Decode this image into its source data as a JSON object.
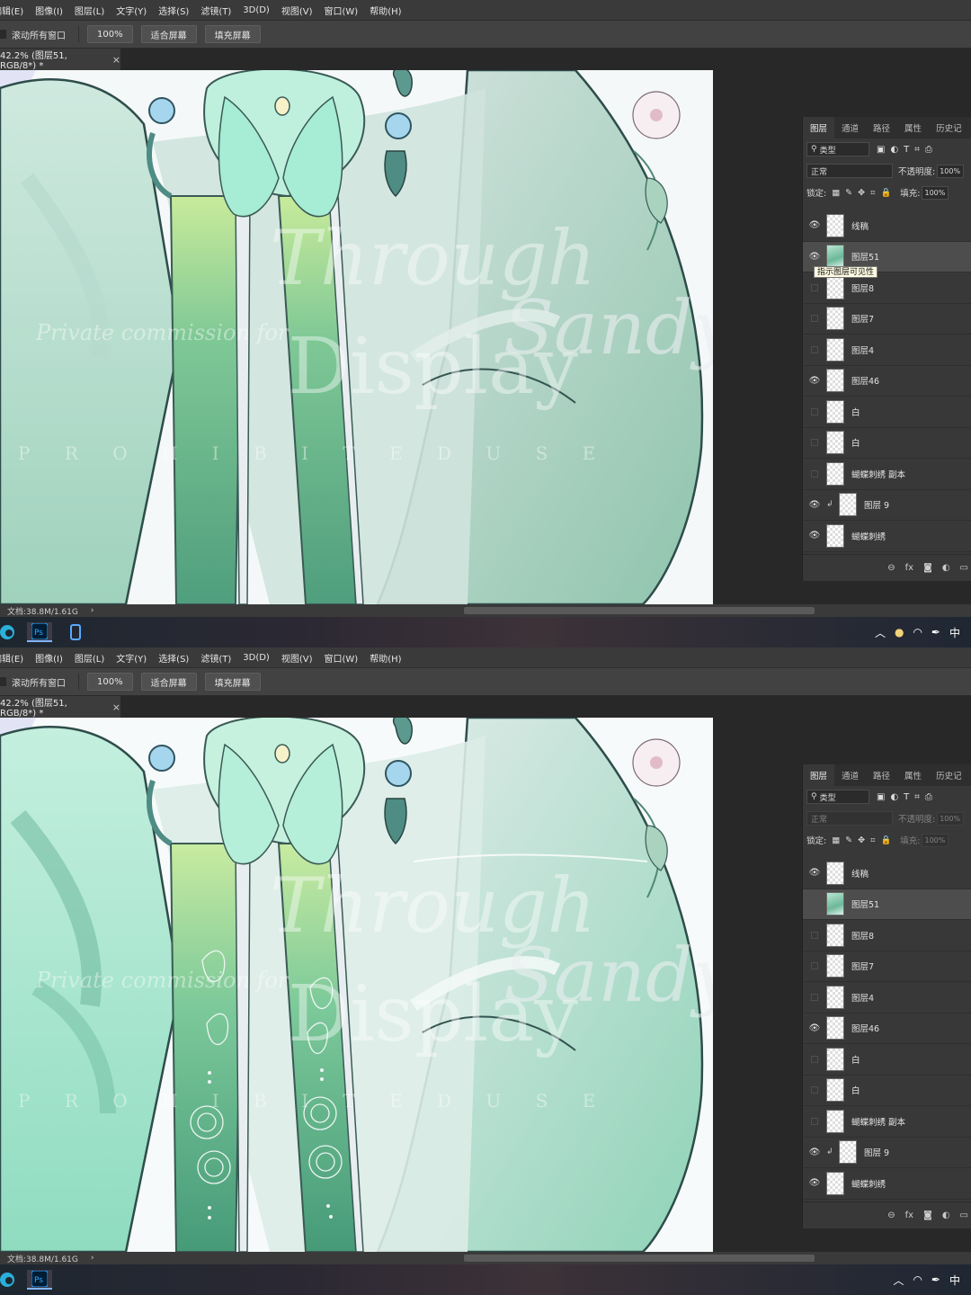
{
  "menu": [
    "编辑(E)",
    "图像(I)",
    "图层(L)",
    "文字(Y)",
    "选择(S)",
    "滤镜(T)",
    "3D(D)",
    "视图(V)",
    "窗口(W)",
    "帮助(H)"
  ],
  "options": {
    "scroll_all": "滚动所有窗口",
    "zoom": "100%",
    "fit_screen": "适合屏幕",
    "fill_screen": "填充屏幕"
  },
  "doc_tab": {
    "title": "42.2% (图层51, RGB/8*) *",
    "close": "×"
  },
  "status": {
    "doc_size": "文档:38.8M/1.61G"
  },
  "panel": {
    "tabs": [
      "图层",
      "通道",
      "路径",
      "属性",
      "历史记"
    ],
    "kind": "类型",
    "blend_mode": "正常",
    "opacity_label": "不透明度:",
    "opacity": "100%",
    "lock_label": "锁定:",
    "fill_label": "填充:",
    "fill": "100%",
    "tooltip": "指示图层可见性"
  },
  "watermark": {
    "line1": "Through",
    "line2": "Display",
    "line3": "Sandy",
    "line4": "P R O H I B I T E D   U S E",
    "line5": "Private commission for"
  },
  "tray": {
    "ime": "中"
  },
  "screens": [
    {
      "layers": [
        {
          "name": "线稿",
          "visible": true
        },
        {
          "name": "图层51",
          "visible": true,
          "selected": true,
          "thumb": "image"
        },
        {
          "name": "图层8",
          "visible": false
        },
        {
          "name": "图层7",
          "visible": false
        },
        {
          "name": "图层4",
          "visible": false
        },
        {
          "name": "图层46",
          "visible": true
        },
        {
          "name": "白",
          "visible": false
        },
        {
          "name": "白",
          "visible": false
        },
        {
          "name": "蝴蝶刺绣 副本",
          "visible": false
        },
        {
          "name": "图层 9",
          "visible": true,
          "clipped": true
        },
        {
          "name": "蝴蝶刺绣",
          "visible": true
        }
      ]
    },
    {
      "layers": [
        {
          "name": "线稿",
          "visible": true
        },
        {
          "name": "图层51",
          "visible": false,
          "selected": true,
          "thumb": "image"
        },
        {
          "name": "图层8",
          "visible": false
        },
        {
          "name": "图层7",
          "visible": false
        },
        {
          "name": "图层4",
          "visible": false
        },
        {
          "name": "图层46",
          "visible": true
        },
        {
          "name": "白",
          "visible": false
        },
        {
          "name": "白",
          "visible": false
        },
        {
          "name": "蝴蝶刺绣 副本",
          "visible": false
        },
        {
          "name": "图层 9",
          "visible": true,
          "clipped": true
        },
        {
          "name": "蝴蝶刺绣",
          "visible": true
        }
      ]
    }
  ]
}
